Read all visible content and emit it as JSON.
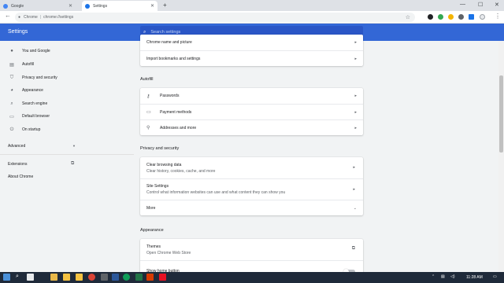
{
  "browser": {
    "tabs": [
      {
        "label": "Google",
        "active": false,
        "favicon_color": "#4285f4"
      },
      {
        "label": "Settings",
        "active": true,
        "favicon_color": "#1a73e8"
      }
    ],
    "new_tab_icon": "plus-icon",
    "address": {
      "scheme_label": "Chrome",
      "separator": "|",
      "url": "chrome://settings"
    },
    "extension_colors": [
      "#202124",
      "#34a853",
      "#f4b400",
      "#5f6368",
      "#1a73e8"
    ]
  },
  "settings": {
    "title": "Settings",
    "search_placeholder": "Search settings",
    "accent_color": "#3367d6"
  },
  "sidebar": {
    "items": [
      {
        "label": "You and Google",
        "icon": "person-icon"
      },
      {
        "label": "Autofill",
        "icon": "autofill-icon"
      },
      {
        "label": "Privacy and security",
        "icon": "shield-icon"
      },
      {
        "label": "Appearance",
        "icon": "palette-icon"
      },
      {
        "label": "Search engine",
        "icon": "search-icon"
      },
      {
        "label": "Default browser",
        "icon": "browser-icon"
      },
      {
        "label": "On startup",
        "icon": "power-icon"
      }
    ],
    "advanced_label": "Advanced",
    "extensions_label": "Extensions",
    "about_label": "About Chrome"
  },
  "main": {
    "top_card": {
      "rows": [
        {
          "label": "Chrome name and picture"
        },
        {
          "label": "Import bookmarks and settings"
        }
      ]
    },
    "autofill": {
      "title": "Autofill",
      "rows": [
        {
          "label": "Passwords",
          "icon": "key-icon"
        },
        {
          "label": "Payment methods",
          "icon": "credit-card-icon"
        },
        {
          "label": "Addresses and more",
          "icon": "location-pin-icon"
        }
      ]
    },
    "privacy": {
      "title": "Privacy and security",
      "rows": [
        {
          "label": "Clear browsing data",
          "sub": "Clear history, cookies, cache, and more"
        },
        {
          "label": "Site Settings",
          "sub": "Control what information websites can use and what content they can show you"
        },
        {
          "label": "More"
        }
      ]
    },
    "appearance": {
      "title": "Appearance",
      "rows": [
        {
          "label": "Themes",
          "sub": "Open Chrome Web Store"
        },
        {
          "label": "Show home button",
          "toggle_on": false
        }
      ]
    }
  },
  "taskbar": {
    "time": "11:28 AM",
    "app_colors": [
      "#4a90d9",
      "#e8eaed",
      "#e8b84a",
      "#f5c242",
      "#db4437",
      "#2b579a",
      "#0f9d58",
      "#d83b01",
      "#217346",
      "#e81123",
      "#c1c1c1"
    ]
  }
}
